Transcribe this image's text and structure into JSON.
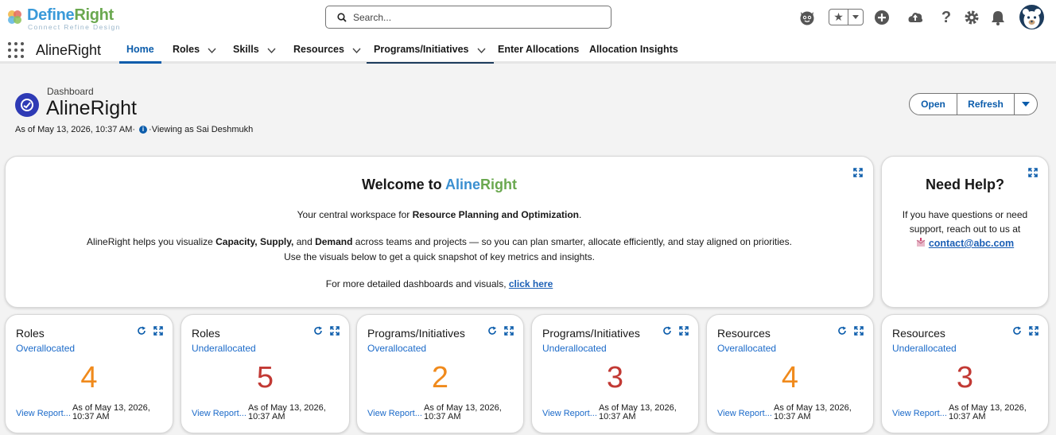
{
  "brand": {
    "name_a": "Define",
    "name_b": "Right",
    "tagline": "Connect Refine Design"
  },
  "search": {
    "placeholder": "Search..."
  },
  "header_icons": [
    "einstein-icon",
    "favorites-icon",
    "add-icon",
    "setup-assistant-icon",
    "help-icon",
    "settings-icon",
    "notifications-icon",
    "avatar"
  ],
  "nav": {
    "app_name": "AlineRight",
    "items": [
      {
        "label": "Home",
        "chevron": false
      },
      {
        "label": "Roles",
        "chevron": true
      },
      {
        "label": "Skills",
        "chevron": true
      },
      {
        "label": "Resources",
        "chevron": true
      },
      {
        "label": "Programs/Initiatives",
        "chevron": true
      },
      {
        "label": "Enter Allocations",
        "chevron": false
      },
      {
        "label": "Allocation Insights",
        "chevron": false
      }
    ]
  },
  "dashboard": {
    "label": "Dashboard",
    "title": "AlineRight",
    "as_of": "As of May 13, 2026, 10:37 AM·",
    "viewing": "·Viewing as Sai Deshmukh",
    "buttons": {
      "open": "Open",
      "refresh": "Refresh"
    }
  },
  "welcome": {
    "title_prefix": "Welcome to ",
    "title_a": "Aline",
    "title_b": "Right",
    "line1_pre": "Your central workspace for ",
    "line1_bold": "Resource Planning and Optimization",
    "line1_post": ".",
    "line2_a": "AlineRight helps you visualize ",
    "line2_b": "Capacity, Supply,",
    "line2_c": " and ",
    "line2_d": "Demand",
    "line2_e": " across teams and projects — so you can plan smarter, allocate efficiently, and stay aligned on priorities.",
    "line3": "Use the visuals below to get a quick snapshot of key metrics and insights.",
    "line4_pre": "For more detailed dashboards and visuals, ",
    "line4_link": "click here"
  },
  "help": {
    "title": "Need Help?",
    "line1": "If you have questions or need",
    "line2": "support, reach out to us at",
    "email": "contact@abc.com"
  },
  "kpis": [
    {
      "title": "Roles",
      "subtitle": "Overallocated",
      "value": "4",
      "color": "#f08a1c",
      "link": "View Report...",
      "asof1": "As of May 13, 2026,",
      "asof2": "10:37 AM"
    },
    {
      "title": "Roles",
      "subtitle": "Underallocated",
      "value": "5",
      "color": "#c23934",
      "link": "View Report...",
      "asof1": "As of May 13, 2026,",
      "asof2": "10:37 AM"
    },
    {
      "title": "Programs/Initiatives",
      "subtitle": "Overallocated",
      "value": "2",
      "color": "#f08a1c",
      "link": "View Report...",
      "asof1": "As of May 13, 2026,",
      "asof2": "10:37 AM"
    },
    {
      "title": "Programs/Initiatives",
      "subtitle": "Underallocated",
      "value": "3",
      "color": "#c23934",
      "link": "View Report...",
      "asof1": "As of May 13, 2026,",
      "asof2": "10:37 AM"
    },
    {
      "title": "Resources",
      "subtitle": "Overallocated",
      "value": "4",
      "color": "#f08a1c",
      "link": "View Report...",
      "asof1": "As of May 13, 2026,",
      "asof2": "10:37 AM"
    },
    {
      "title": "Resources",
      "subtitle": "Underallocated",
      "value": "3",
      "color": "#c23934",
      "link": "View Report...",
      "asof1": "As of May 13, 2026,",
      "asof2": "10:37 AM"
    }
  ]
}
